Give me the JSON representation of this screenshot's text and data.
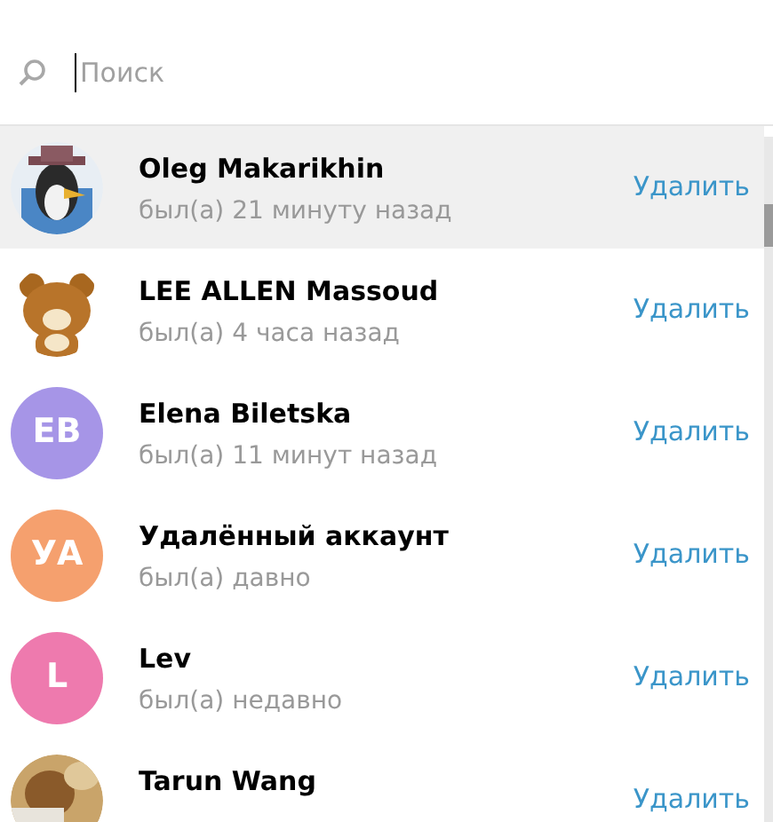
{
  "search": {
    "placeholder": "Поиск"
  },
  "contacts": [
    {
      "name": "Oleg Makarikhin",
      "status": "был(а) 21 минуту назад",
      "action": "Удалить",
      "selected": true
    },
    {
      "name": "LEE ALLEN Massoud",
      "status": "был(а) 4 часа назад",
      "action": "Удалить",
      "selected": false
    },
    {
      "name": "Elena Biletska",
      "status": "был(а) 11 минут назад",
      "action": "Удалить",
      "selected": false,
      "avatar": {
        "kind": "initials",
        "initials": "EB",
        "color": "#a695e7"
      }
    },
    {
      "name": "Удалённый аккаунт",
      "status": "был(а) давно",
      "action": "Удалить",
      "selected": false,
      "avatar": {
        "kind": "initials",
        "initials": "УА",
        "color": "#f5a06e"
      }
    },
    {
      "name": "Lev",
      "status": "был(а) недавно",
      "action": "Удалить",
      "selected": false,
      "avatar": {
        "kind": "initials",
        "initials": "L",
        "color": "#ee7aae"
      }
    },
    {
      "name": "Tarun Wang",
      "action": "Удалить",
      "selected": false
    }
  ]
}
